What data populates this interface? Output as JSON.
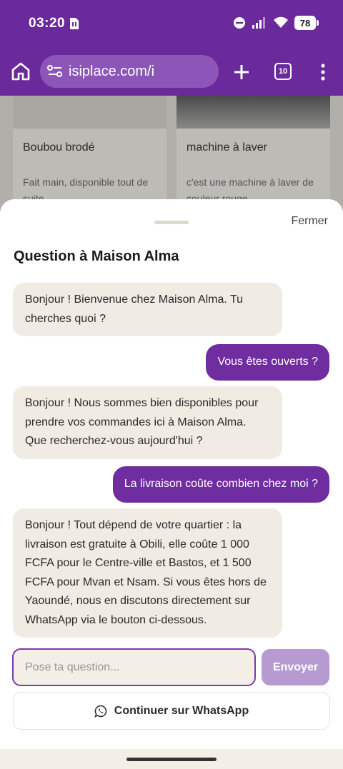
{
  "status": {
    "time": "03:20",
    "battery": "78"
  },
  "browser": {
    "url": "isiplace.com/i",
    "tab_count": "10"
  },
  "background_cards": [
    {
      "title": "Boubou brodé",
      "description": "Fait main, disponible tout de suite"
    },
    {
      "title": "machine à laver",
      "description": "c'est une machine à laver de couleur rouge"
    }
  ],
  "sheet": {
    "close_label": "Fermer",
    "title": "Question à Maison Alma",
    "messages": [
      {
        "from": "bot",
        "text": "Bonjour ! Bienvenue chez Maison Alma. Tu cherches quoi ?"
      },
      {
        "from": "user",
        "text": "Vous êtes ouverts ?"
      },
      {
        "from": "bot",
        "text": "Bonjour ! Nous sommes bien disponibles pour prendre vos commandes ici à Maison Alma. Que recherchez-vous aujourd'hui ?"
      },
      {
        "from": "user",
        "text": "La livraison coûte combien chez moi ?"
      },
      {
        "from": "bot",
        "text": "Bonjour ! Tout dépend de votre quartier : la livraison est gratuite à Obili, elle coûte 1 000 FCFA pour le Centre-ville et Bastos, et 1 500 FCFA pour Mvan et Nsam. Si vous êtes hors de Yaoundé, nous en discutons directement sur WhatsApp via le bouton ci-dessous."
      }
    ],
    "input_placeholder": "Pose ta question...",
    "input_value": "",
    "send_label": "Envoyer",
    "whatsapp_label": "Continuer sur WhatsApp"
  },
  "colors": {
    "brand_purple": "#6a2a9c",
    "user_bubble": "#6f2da0",
    "bot_bubble": "#f0ebe3",
    "send_disabled": "#b69ad0"
  }
}
